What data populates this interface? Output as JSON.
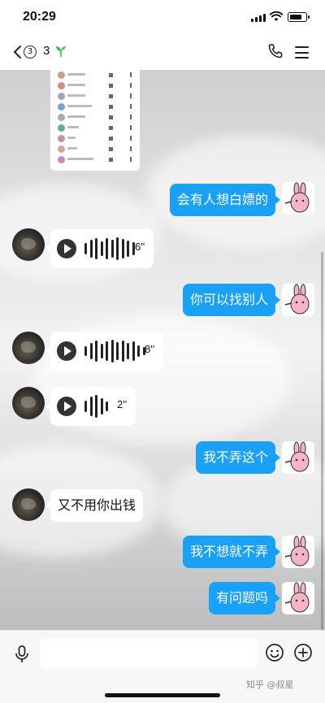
{
  "status_bar": {
    "time": "20:29"
  },
  "header": {
    "back_badge": "3",
    "title": "3",
    "title_emoji": "sprout"
  },
  "messages": [
    {
      "side": "out",
      "type": "text",
      "text": "会有人想白嫖的"
    },
    {
      "side": "in",
      "type": "voice",
      "duration": "6''"
    },
    {
      "side": "out",
      "type": "text",
      "text": "你可以找别人"
    },
    {
      "side": "in",
      "type": "voice",
      "duration": "8''"
    },
    {
      "side": "in",
      "type": "voice",
      "duration": "2''"
    },
    {
      "side": "out",
      "type": "text",
      "text": "我不弄这个"
    },
    {
      "side": "in",
      "type": "text",
      "text": "又不用你出钱"
    },
    {
      "side": "out",
      "type": "text",
      "text": "我不想就不弄"
    },
    {
      "side": "out",
      "type": "text",
      "text": "有问题吗"
    }
  ],
  "input_bar": {
    "placeholder": ""
  },
  "watermark": "知乎 @叔星",
  "colors": {
    "bubble_out": "#1aa0f4",
    "bubble_in": "#ffffff",
    "accent_sprout": "#3cb95c"
  },
  "icons": [
    "chevron-left-icon",
    "phone-icon",
    "menu-icon",
    "microphone-icon",
    "emoji-icon",
    "plus-circle-icon",
    "play-icon"
  ]
}
